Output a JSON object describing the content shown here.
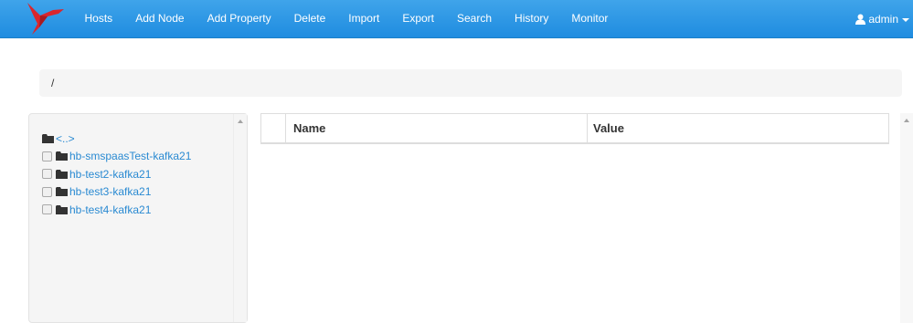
{
  "navbar": {
    "logo_icon": "red-bird-logo",
    "items": [
      {
        "label": "Hosts"
      },
      {
        "label": "Add Node"
      },
      {
        "label": "Add Property"
      },
      {
        "label": "Delete"
      },
      {
        "label": "Import"
      },
      {
        "label": "Export"
      },
      {
        "label": "Search"
      },
      {
        "label": "History"
      },
      {
        "label": "Monitor"
      }
    ],
    "user": {
      "icon": "user-icon",
      "label": "admin"
    },
    "colors": {
      "background": "#2b97e5",
      "text": "#ffffff",
      "logo": "#d9262d"
    }
  },
  "breadcrumb": {
    "path": "/"
  },
  "tree": {
    "parent_label": "<..>",
    "nodes": [
      {
        "label": "hb-smspaasTest-kafka21"
      },
      {
        "label": "hb-test2-kafka21"
      },
      {
        "label": "hb-test3-kafka21"
      },
      {
        "label": "hb-test4-kafka21"
      }
    ],
    "link_color": "#2a8ad2"
  },
  "table": {
    "columns": [
      "",
      "Name",
      "Value"
    ],
    "rows": []
  }
}
